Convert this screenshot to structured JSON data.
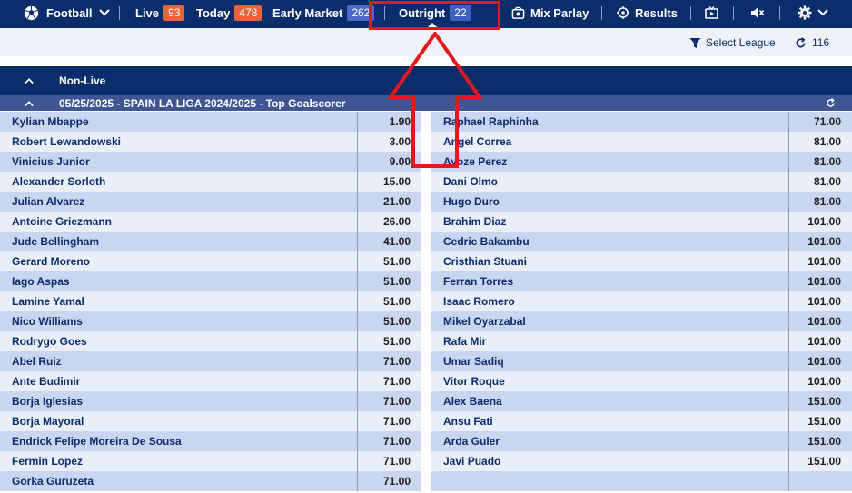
{
  "nav": {
    "sport": "Football",
    "live_label": "Live",
    "live_count": "93",
    "today_label": "Today",
    "today_count": "478",
    "early_label": "Early Market",
    "early_count": "262",
    "outright_label": "Outright",
    "outright_count": "22",
    "mix_label": "Mix Parlay",
    "results_label": "Results"
  },
  "subbar": {
    "select_league": "Select League",
    "refresh_count": "116"
  },
  "section": {
    "title": "Non-Live"
  },
  "league": {
    "title": "05/25/2025 - SPAIN LA LIGA 2024/2025 - Top Goalscorer"
  },
  "left_rows": [
    {
      "name": "Kylian Mbappe",
      "odds": "1.90"
    },
    {
      "name": "Robert Lewandowski",
      "odds": "3.00"
    },
    {
      "name": "Vinicius Junior",
      "odds": "9.00"
    },
    {
      "name": "Alexander Sorloth",
      "odds": "15.00"
    },
    {
      "name": "Julian Alvarez",
      "odds": "21.00"
    },
    {
      "name": "Antoine Griezmann",
      "odds": "26.00"
    },
    {
      "name": "Jude Bellingham",
      "odds": "41.00"
    },
    {
      "name": "Gerard Moreno",
      "odds": "51.00"
    },
    {
      "name": "Iago Aspas",
      "odds": "51.00"
    },
    {
      "name": "Lamine Yamal",
      "odds": "51.00"
    },
    {
      "name": "Nico Williams",
      "odds": "51.00"
    },
    {
      "name": "Rodrygo Goes",
      "odds": "51.00"
    },
    {
      "name": "Abel Ruiz",
      "odds": "71.00"
    },
    {
      "name": "Ante Budimir",
      "odds": "71.00"
    },
    {
      "name": "Borja Iglesias",
      "odds": "71.00"
    },
    {
      "name": "Borja Mayoral",
      "odds": "71.00"
    },
    {
      "name": "Endrick Felipe Moreira De Sousa",
      "odds": "71.00"
    },
    {
      "name": "Fermin Lopez",
      "odds": "71.00"
    },
    {
      "name": "Gorka Guruzeta",
      "odds": "71.00"
    }
  ],
  "right_rows": [
    {
      "name": "Raphael Raphinha",
      "odds": "71.00"
    },
    {
      "name": "Angel Correa",
      "odds": "81.00"
    },
    {
      "name": "Ayoze Perez",
      "odds": "81.00"
    },
    {
      "name": "Dani Olmo",
      "odds": "81.00"
    },
    {
      "name": "Hugo Duro",
      "odds": "81.00"
    },
    {
      "name": "Brahim Diaz",
      "odds": "101.00"
    },
    {
      "name": "Cedric Bakambu",
      "odds": "101.00"
    },
    {
      "name": "Cristhian Stuani",
      "odds": "101.00"
    },
    {
      "name": "Ferran Torres",
      "odds": "101.00"
    },
    {
      "name": "Isaac Romero",
      "odds": "101.00"
    },
    {
      "name": "Mikel Oyarzabal",
      "odds": "101.00"
    },
    {
      "name": "Rafa Mir",
      "odds": "101.00"
    },
    {
      "name": "Umar Sadiq",
      "odds": "101.00"
    },
    {
      "name": "Vitor Roque",
      "odds": "101.00"
    },
    {
      "name": "Alex Baena",
      "odds": "151.00"
    },
    {
      "name": "Ansu Fati",
      "odds": "151.00"
    },
    {
      "name": "Arda Guler",
      "odds": "151.00"
    },
    {
      "name": "Javi Puado",
      "odds": "151.00"
    },
    {
      "name": "",
      "odds": ""
    }
  ],
  "colors": {
    "nav_bg": "#0c2d6b",
    "highlight": "#e0191f",
    "row_odd": "#c8d6ef",
    "row_even": "#e9eef8"
  },
  "icons": [
    "football-icon",
    "chevron-down-icon",
    "mix-parlay-icon",
    "results-target-icon",
    "tv-icon",
    "mute-icon",
    "gear-icon",
    "filter-icon",
    "refresh-icon",
    "chevron-up-icon"
  ]
}
